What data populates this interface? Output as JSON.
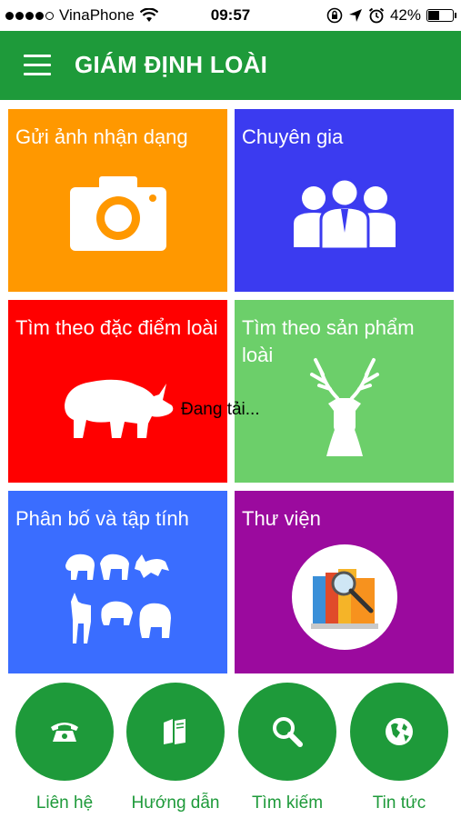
{
  "status_bar": {
    "carrier": "VinaPhone",
    "time": "09:57",
    "battery": "42%",
    "battery_level": 0.42,
    "signal_bars": 4
  },
  "header": {
    "title": "GIÁM ĐỊNH LOÀI",
    "background": "#1e9a3a"
  },
  "tiles": [
    {
      "label": "Gửi ảnh nhận dạng",
      "color": "#ff9800",
      "icon": "camera-icon"
    },
    {
      "label": "Chuyên gia",
      "color": "#3b3bf0",
      "icon": "experts-icon"
    },
    {
      "label": "Tìm theo đặc điểm loài",
      "color": "#ff0000",
      "icon": "rhino-icon"
    },
    {
      "label": "Tìm theo sản phẩm loài",
      "color": "#6ccf6a",
      "icon": "deer-head-icon"
    },
    {
      "label": "Phân bố và tập tính",
      "color": "#3a6dff",
      "icon": "animals-icon"
    },
    {
      "label": "Thư viện",
      "color": "#9b0a9e",
      "icon": "library-icon"
    }
  ],
  "loading_text": "Đang tải...",
  "bottom_nav": [
    {
      "label": "Liên hệ",
      "icon": "phone-icon"
    },
    {
      "label": "Hướng dẫn",
      "icon": "books-icon"
    },
    {
      "label": "Tìm kiếm",
      "icon": "search-icon"
    },
    {
      "label": "Tin tức",
      "icon": "globe-icon"
    }
  ]
}
